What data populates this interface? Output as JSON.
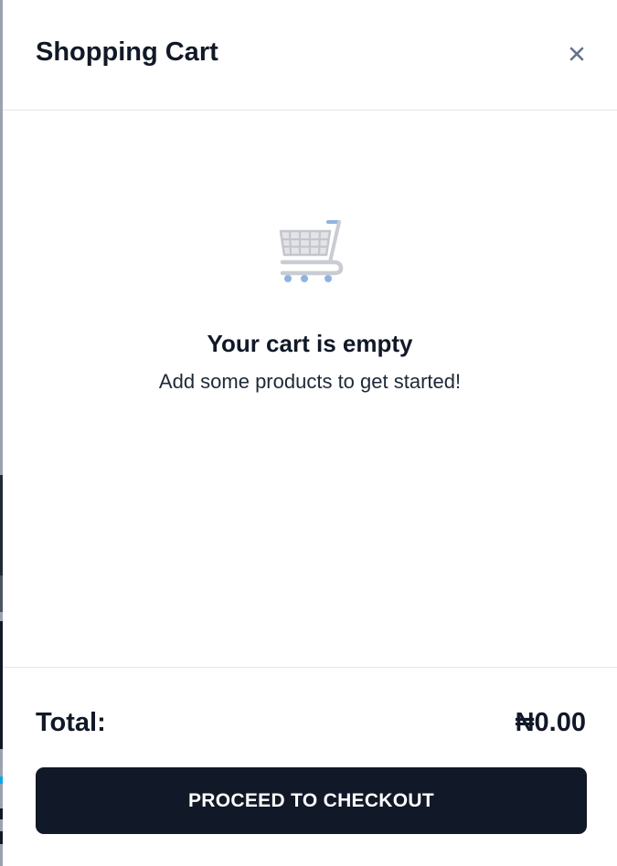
{
  "header": {
    "title": "Shopping Cart",
    "close_icon": "close-icon"
  },
  "empty_state": {
    "icon": "shopping-cart-icon",
    "title": "Your cart is empty",
    "subtitle": "Add some products to get started!"
  },
  "footer": {
    "total_label": "Total:",
    "total_value": "₦0.00",
    "checkout_label": "PROCEED TO CHECKOUT"
  },
  "colors": {
    "text_primary": "#111827",
    "button_bg": "#111827",
    "button_text": "#ffffff",
    "divider": "#e5e7eb",
    "close_icon": "#64748b"
  }
}
